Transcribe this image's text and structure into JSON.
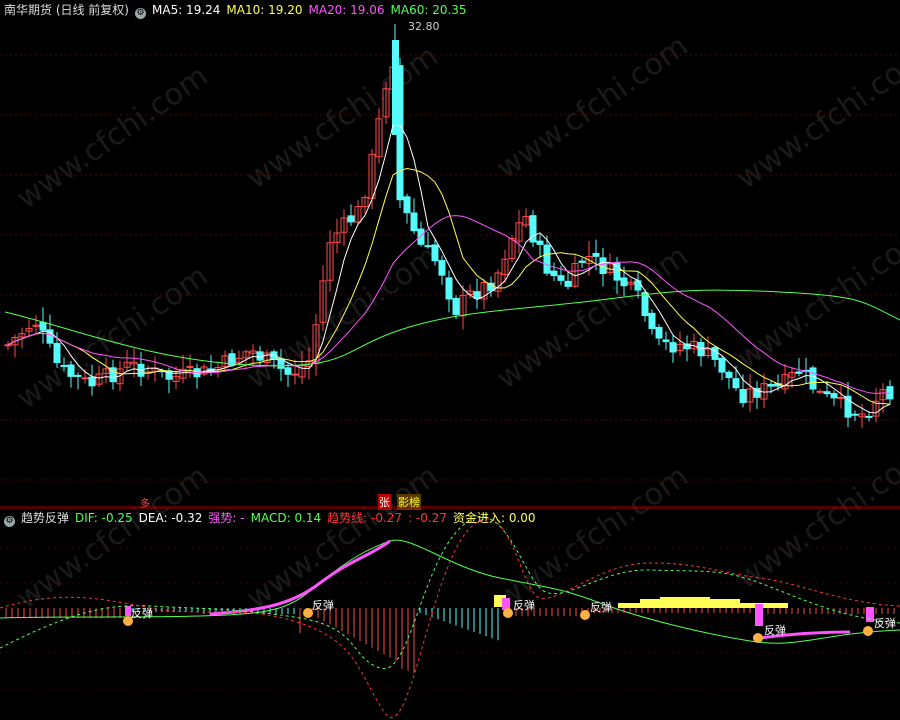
{
  "main": {
    "title": "南华期货 (日线 前复权)",
    "ma5_label": "MA5: 19.24",
    "ma10_label": "MA10: 19.20",
    "ma20_label": "MA20: 19.06",
    "ma60_label": "MA60: 20.35",
    "peak_label": "32.80",
    "mark_zhang": "张",
    "mark_yingjie": "影榜",
    "mark_small": "多"
  },
  "indicator": {
    "title": "趋势反弹",
    "dif_label": "DIF: -0.25",
    "dea_label": "DEA: -0.32",
    "qiang_label": "强势: -",
    "macd_label": "MACD: 0.14",
    "trend_label": "趋势线: -0.27",
    "trend2_label": ": -0.27",
    "fund_label": "资金进入: 0.00",
    "rebound_labels": [
      "反弹",
      "反弹",
      "反弹",
      "反弹",
      "反弹",
      "反弹"
    ]
  },
  "watermark": "www.cfchi.com",
  "colors": {
    "up": "#ff4a4a",
    "down": "#54fcfc",
    "ma5": "#ffffff",
    "ma10": "#ffff54",
    "ma20": "#ff54ff",
    "ma60": "#54ff54",
    "dif": "#54ff54",
    "dea": "#ffffff",
    "qiang": "#ff54ff",
    "macd": "#ffff54",
    "trend": "#ff3333",
    "fund": "#ffff54"
  }
}
